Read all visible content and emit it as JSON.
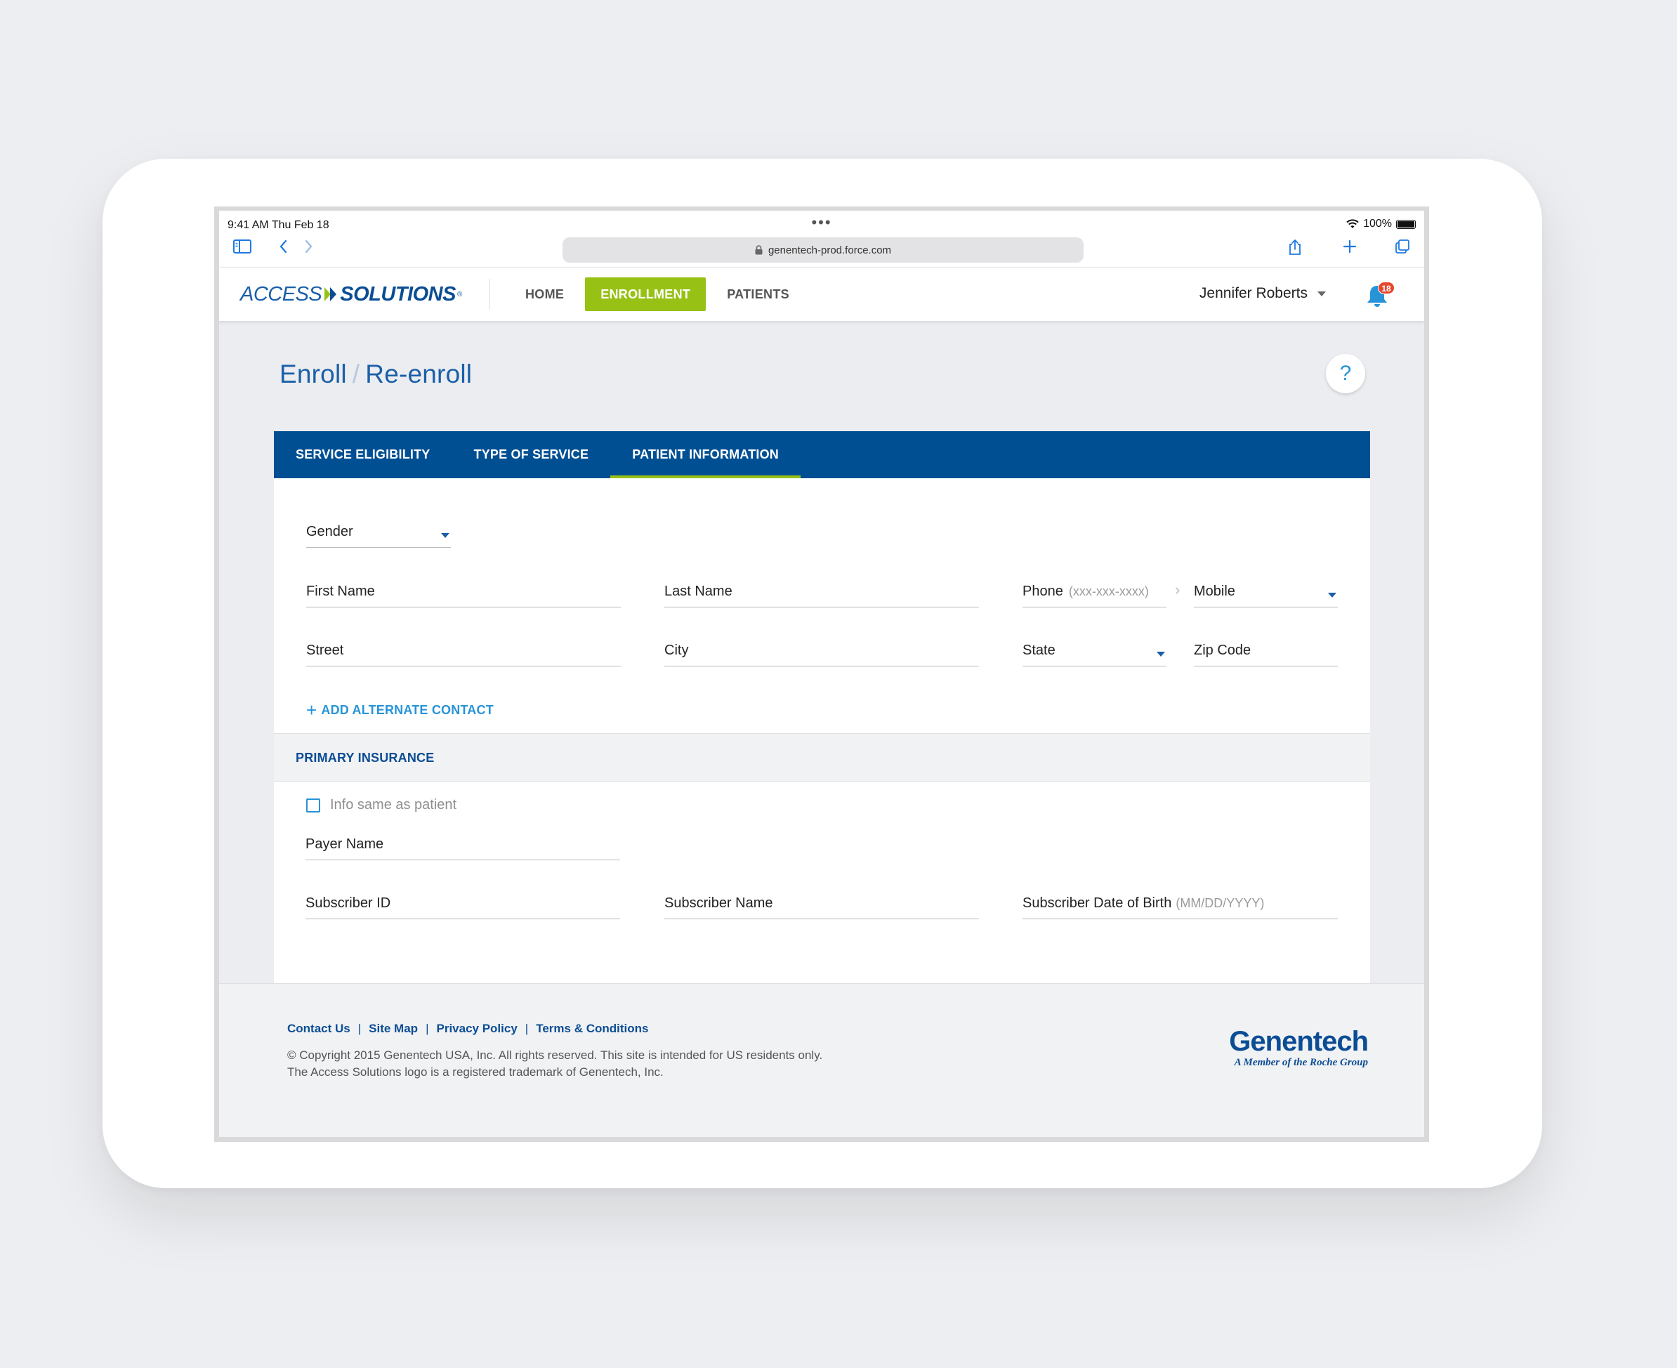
{
  "status_bar": {
    "time": "9:41 AM   Thu Feb 18",
    "dots": "•••",
    "battery": "100%"
  },
  "browser": {
    "url": "genentech-prod.force.com"
  },
  "header": {
    "logo_access": "ACCESS",
    "logo_solutions": "SOLUTIONS",
    "nav": [
      {
        "label": "HOME"
      },
      {
        "label": "ENROLLMENT",
        "active": true
      },
      {
        "label": "PATIENTS"
      }
    ],
    "user_name": "Jennifer Roberts",
    "notification_count": "18"
  },
  "page": {
    "title": "Enroll",
    "title_sep": "/",
    "title_sub": "Re-enroll",
    "help_label": "?"
  },
  "tabs": [
    {
      "label": "SERVICE ELIGIBILITY"
    },
    {
      "label": "TYPE OF SERVICE"
    },
    {
      "label": "PATIENT INFORMATION",
      "active": true
    }
  ],
  "patient_form": {
    "gender": "Gender",
    "first_name": "First Name",
    "last_name": "Last Name",
    "phone": "Phone",
    "phone_hint": "(xxx-xxx-xxxx)",
    "phone_type": "Mobile",
    "street": "Street",
    "city": "City",
    "state": "State",
    "zip": "Zip Code",
    "add_contact": "ADD ALTERNATE CONTACT"
  },
  "insurance": {
    "section_title": "PRIMARY INSURANCE",
    "same_as_patient": "Info same as patient",
    "payer_name": "Payer Name",
    "subscriber_id": "Subscriber ID",
    "subscriber_name": "Subscriber Name",
    "subscriber_dob": "Subscriber Date of Birth",
    "subscriber_dob_hint": "(MM/DD/YYYY)"
  },
  "footer": {
    "links": [
      {
        "label": "Contact Us"
      },
      {
        "label": "Site Map"
      },
      {
        "label": "Privacy Policy"
      },
      {
        "label": "Terms & Conditions"
      }
    ],
    "link_sep": "|",
    "copyright": "© Copyright 2015 Genentech USA, Inc.  All rights reserved.  This site is intended for US residents only.",
    "trademark": "The Access Solutions logo is a registered trademark of Genentech, Inc.",
    "brand_name": "Genentech",
    "brand_sub": "A Member of the Roche Group"
  },
  "colors": {
    "primary_blue": "#004f93",
    "accent_green": "#98c115",
    "link_blue": "#2794d8",
    "badge_red": "#e5472f"
  }
}
